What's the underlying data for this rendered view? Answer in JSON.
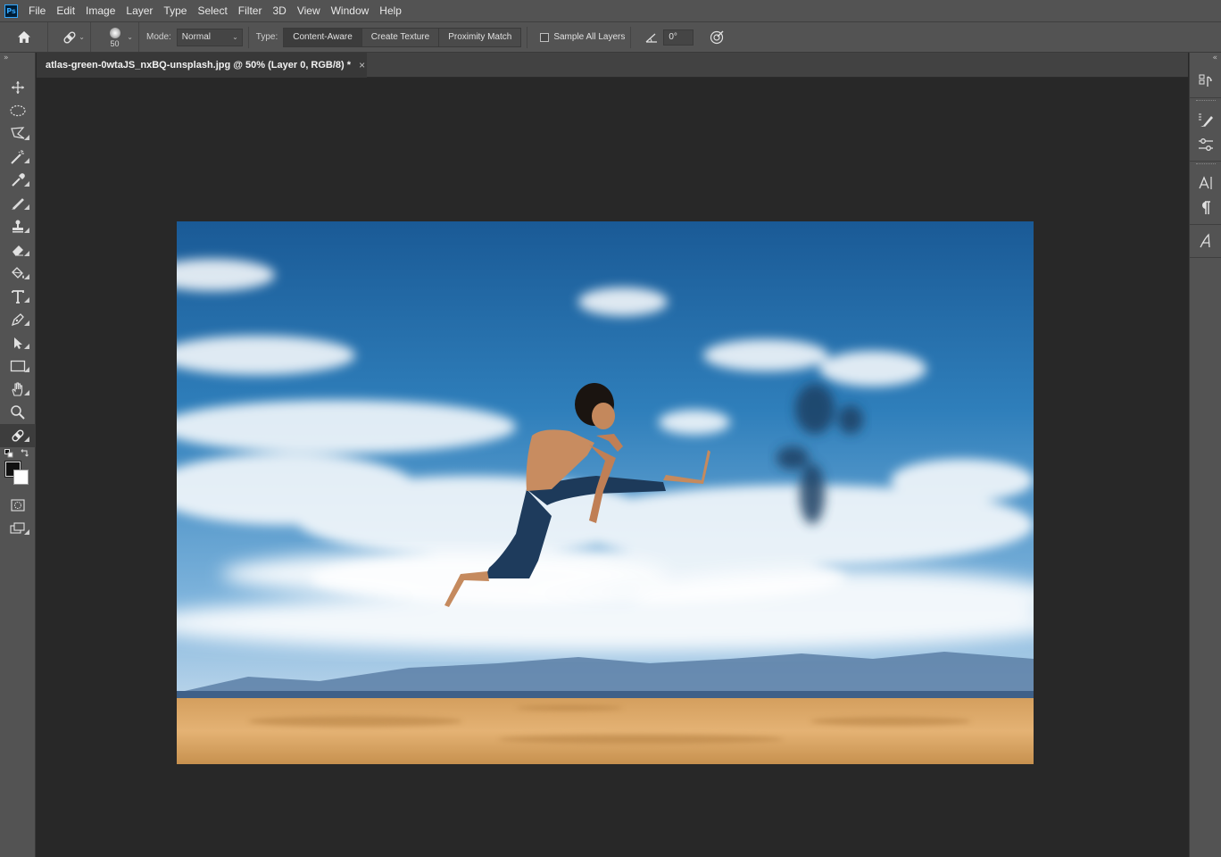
{
  "app": {
    "logo_text": "Ps"
  },
  "menu": {
    "items": [
      "File",
      "Edit",
      "Image",
      "Layer",
      "Type",
      "Select",
      "Filter",
      "3D",
      "View",
      "Window",
      "Help"
    ]
  },
  "options_bar": {
    "brush_size": "50",
    "mode_label": "Mode:",
    "mode_value": "Normal",
    "type_label": "Type:",
    "type_buttons": [
      "Content-Aware",
      "Create Texture",
      "Proximity Match"
    ],
    "active_type": "Content-Aware",
    "sample_all_layers_label": "Sample All Layers",
    "sample_all_layers_checked": false,
    "angle_value": "0°"
  },
  "document": {
    "tab_title": "atlas-green-0wtaJS_nxBQ-unsplash.jpg @ 50% (Layer 0, RGB/8) *",
    "close_glyph": "×"
  },
  "toolbar": {
    "collapse_glyph": "»",
    "tools": [
      "move-tool",
      "elliptical-marquee-tool",
      "polygonal-lasso-tool",
      "magic-wand-tool",
      "eyedropper-tool",
      "brush-tool",
      "clone-stamp-tool",
      "eraser-tool",
      "paint-bucket-tool",
      "type-tool",
      "pen-tool",
      "path-selection-tool",
      "rectangle-tool",
      "hand-tool",
      "zoom-tool",
      "spot-healing-brush-tool"
    ],
    "active_tool": "spot-healing-brush-tool",
    "foreground_color": "#111111",
    "background_color": "#ffffff"
  },
  "right_panel": {
    "collapse_glyph": "«",
    "icons": [
      "history-icon",
      "brushes-icon",
      "adjustments-icon",
      "character-icon",
      "paragraph-icon",
      "glyphs-icon"
    ]
  },
  "colors": {
    "menu_bg": "#535353",
    "canvas_bg": "#282828",
    "accent": "#31a8ff"
  }
}
